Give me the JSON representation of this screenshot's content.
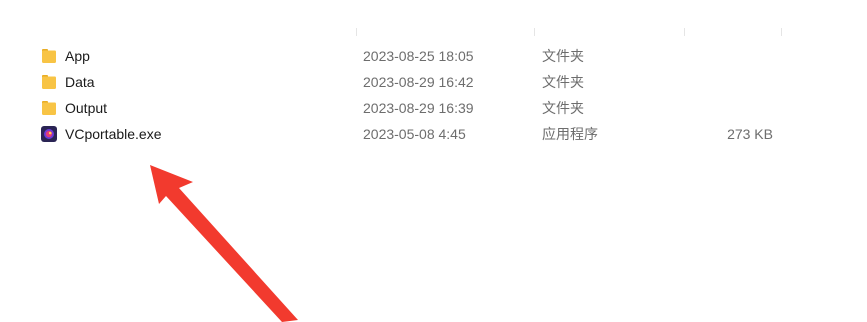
{
  "files": [
    {
      "icon": "folder-icon",
      "name": "App",
      "date_modified": "2023-08-25 18:05",
      "type": "文件夹",
      "size": ""
    },
    {
      "icon": "folder-icon",
      "name": "Data",
      "date_modified": "2023-08-29 16:42",
      "type": "文件夹",
      "size": ""
    },
    {
      "icon": "folder-icon",
      "name": "Output",
      "date_modified": "2023-08-29 16:39",
      "type": "文件夹",
      "size": ""
    },
    {
      "icon": "application-icon",
      "name": "VCportable.exe",
      "date_modified": "2023-05-08 4:45",
      "type": "应用程序",
      "size": "273 KB"
    }
  ],
  "colors": {
    "folder": "#f8c445",
    "folder_shade": "#e9ad24",
    "annotation_arrow": "#f23a2e",
    "app_icon_bg": "#2a2454"
  }
}
